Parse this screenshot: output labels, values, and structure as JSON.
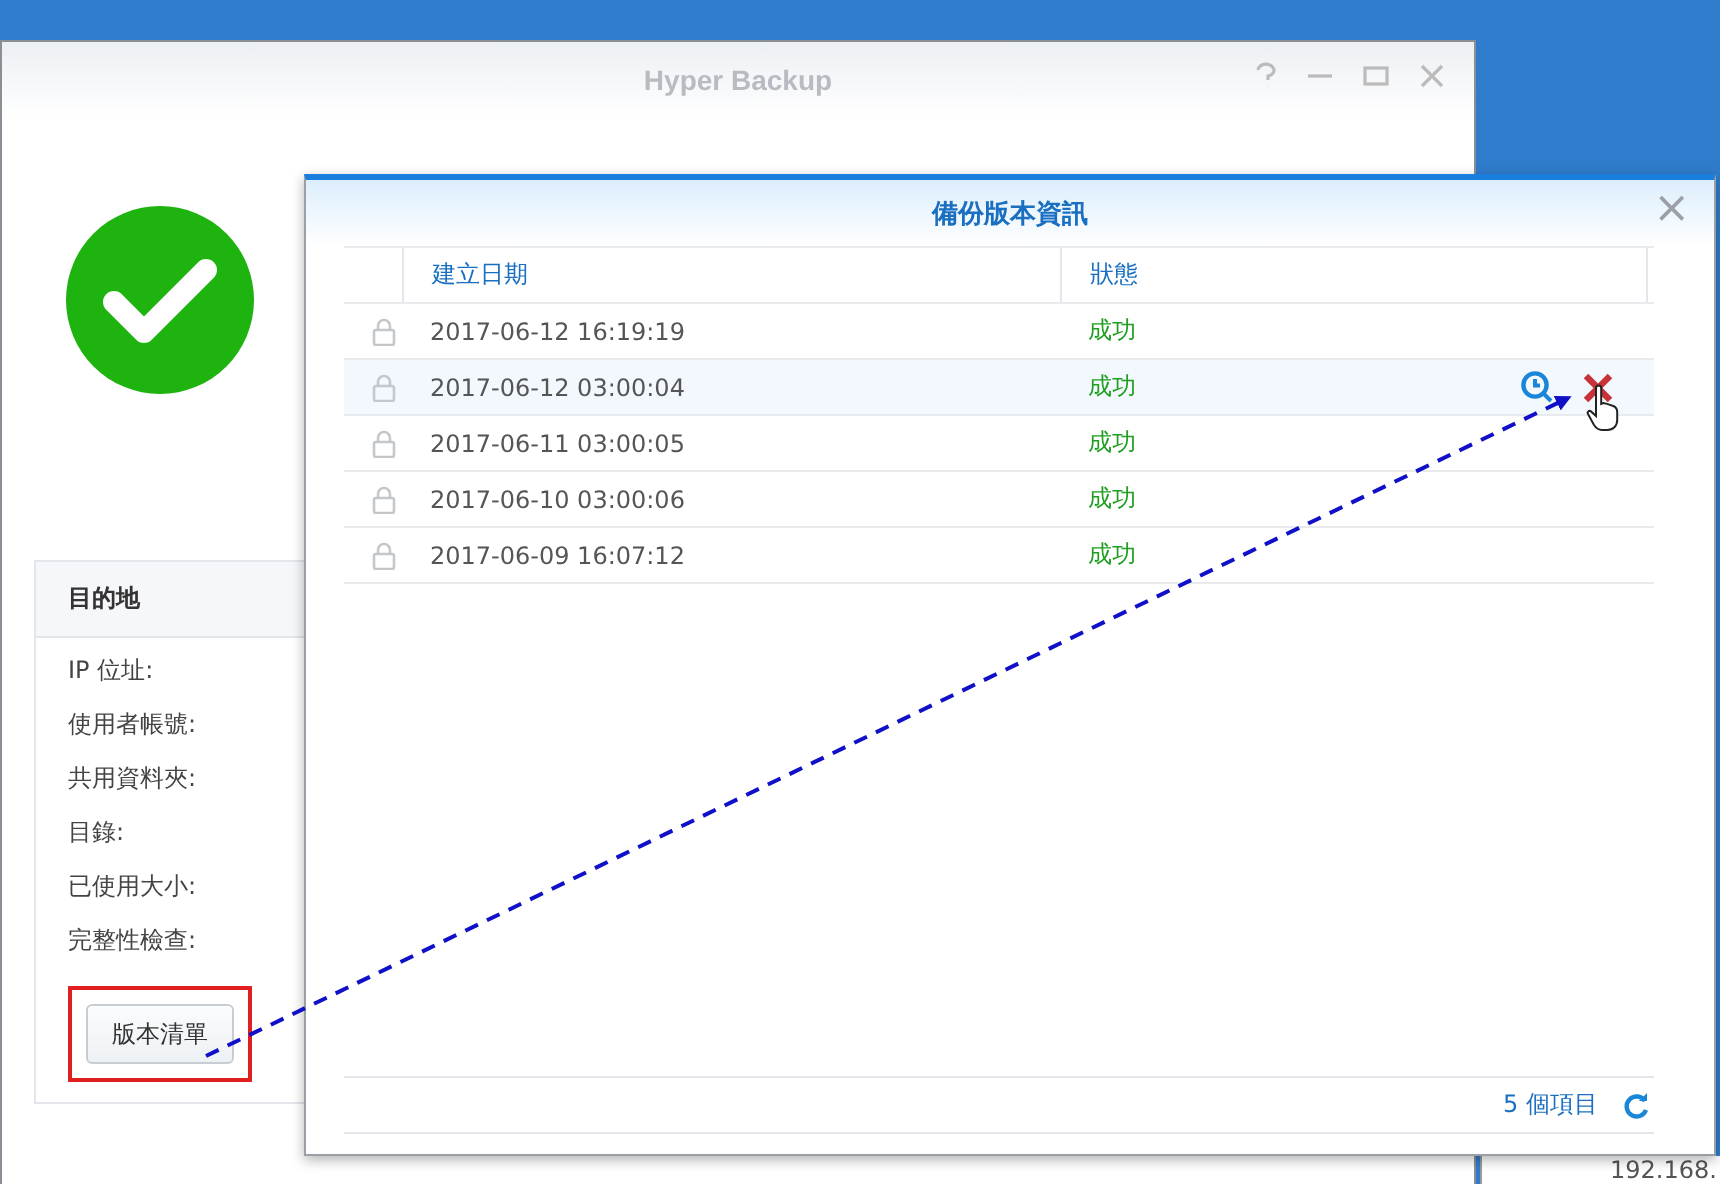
{
  "main_window": {
    "title": "Hyper Backup",
    "destination": {
      "heading": "目的地",
      "fields": [
        "IP 位址:",
        "使用者帳號:",
        "共用資料夾:",
        "目錄:",
        "已使用大小:",
        "完整性檢查:"
      ]
    },
    "button": "版本清單"
  },
  "background_window": {
    "text": "192.168."
  },
  "dialog": {
    "title": "備份版本資訊",
    "close": "×",
    "columns": [
      "建立日期",
      "狀態"
    ],
    "rows": [
      {
        "date": "2017-06-12 16:19:19",
        "status": "成功",
        "highlighted": false
      },
      {
        "date": "2017-06-12 03:00:04",
        "status": "成功",
        "highlighted": true
      },
      {
        "date": "2017-06-11 03:00:05",
        "status": "成功",
        "highlighted": false
      },
      {
        "date": "2017-06-10 03:00:06",
        "status": "成功",
        "highlighted": false
      },
      {
        "date": "2017-06-09 16:07:12",
        "status": "成功",
        "highlighted": false
      }
    ],
    "footer": "5 個項目"
  }
}
